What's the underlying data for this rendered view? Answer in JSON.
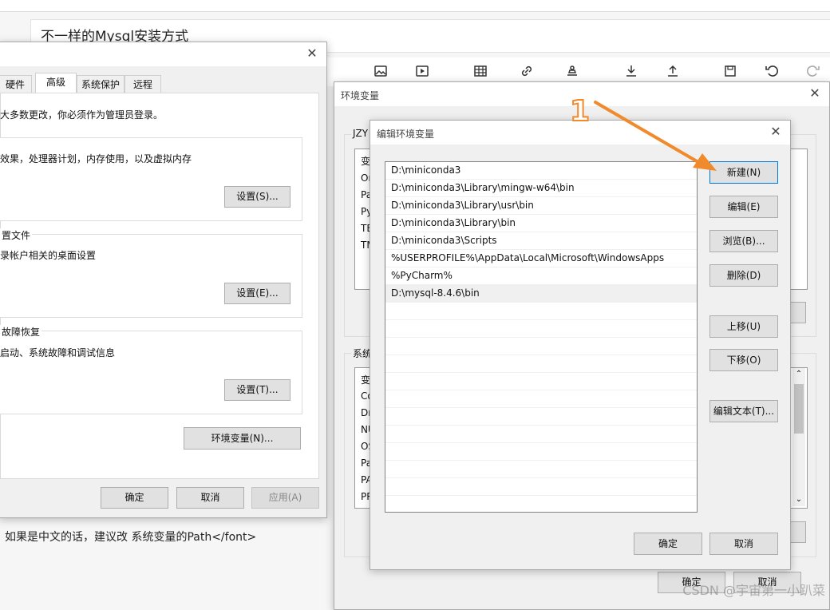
{
  "editor": {
    "title": "不一样的Mysql安装方式",
    "body_text": "如果是中文的话，建议改 系统变量的Path</font>",
    "watermark": "CSDN @宇宙第一小趴菜"
  },
  "sys_props": {
    "tabs": [
      "硬件",
      "高级",
      "系统保护",
      "远程"
    ],
    "admin_notice": "大多数更改，你必须作为管理员登录。",
    "performance_desc": "效果，处理器计划，内存使用，以及虚拟内存",
    "performance_btn": "设置(S)...",
    "profile_label": "置文件",
    "profile_desc": "录帐户相关的桌面设置",
    "profile_btn": "设置(E)...",
    "startup_label": "故障恢复",
    "startup_desc": "启动、系统故障和调试信息",
    "startup_btn": "设置(T)...",
    "env_btn": "环境变量(N)...",
    "ok": "确定",
    "cancel": "取消",
    "apply": "应用(A)"
  },
  "env_vars": {
    "title": "环境变量",
    "user_group_label": "JZY",
    "user_rows": [
      "变",
      "On",
      "Pa",
      "Py",
      "TE",
      "TM"
    ],
    "sys_group_label": "系统",
    "sys_rows": [
      "变",
      "Co",
      "Dr",
      "NU",
      "OS",
      "Pa",
      "PA",
      "PR"
    ],
    "ok": "确定",
    "cancel": "取消"
  },
  "edit_env": {
    "title": "编辑环境变量",
    "paths": [
      "D:\\miniconda3",
      "D:\\miniconda3\\Library\\mingw-w64\\bin",
      "D:\\miniconda3\\Library\\usr\\bin",
      "D:\\miniconda3\\Library\\bin",
      "D:\\miniconda3\\Scripts",
      "%USERPROFILE%\\AppData\\Local\\Microsoft\\WindowsApps",
      "%PyCharm%",
      "D:\\mysql-8.4.6\\bin"
    ],
    "btn_new": "新建(N)",
    "btn_edit": "编辑(E)",
    "btn_browse": "浏览(B)...",
    "btn_delete": "删除(D)",
    "btn_up": "上移(U)",
    "btn_down": "下移(O)",
    "btn_edit_text": "编辑文本(T)...",
    "ok": "确定",
    "cancel": "取消"
  },
  "annotation": {
    "number": "1",
    "arrow_color": "#f08a2c"
  }
}
